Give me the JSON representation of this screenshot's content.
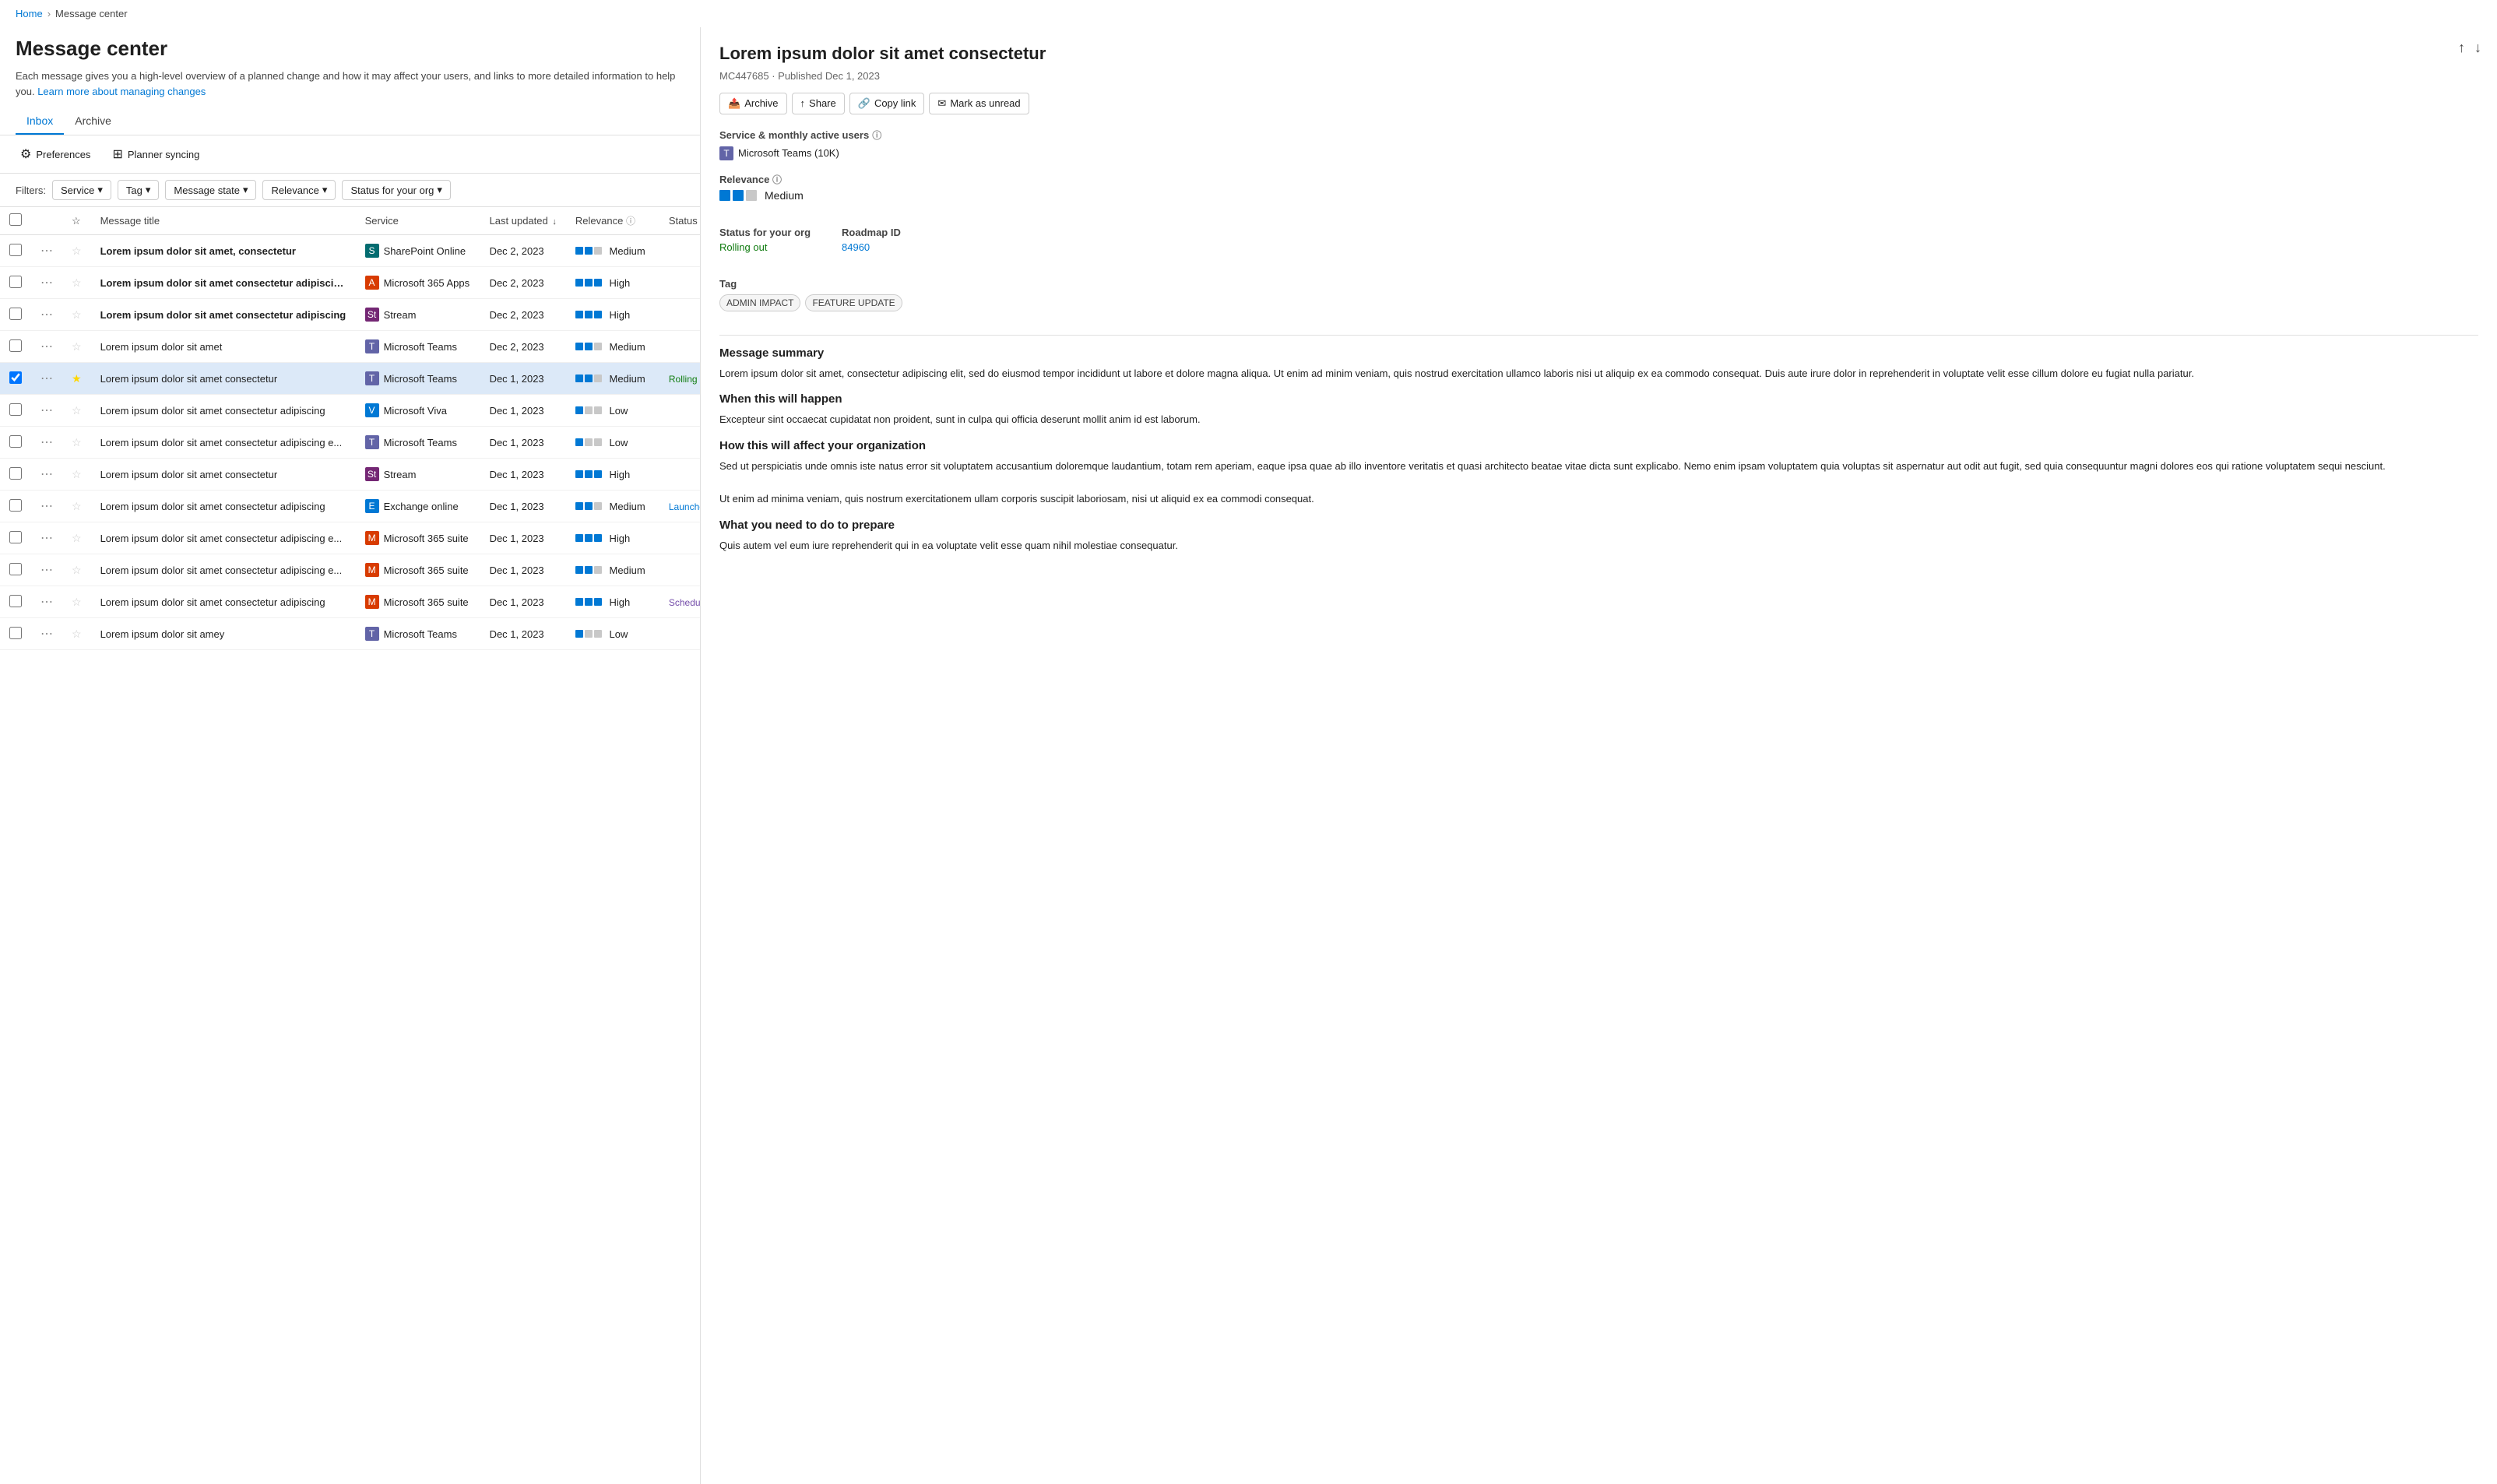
{
  "breadcrumb": {
    "home": "Home",
    "current": "Message center"
  },
  "page": {
    "title": "Message center",
    "description": "Each message gives you a high-level overview of a planned change and how it may affect your users, and links to more detailed information to help you.",
    "learn_more_text": "Learn more about managing changes"
  },
  "tabs": [
    {
      "id": "inbox",
      "label": "Inbox",
      "active": true
    },
    {
      "id": "archive",
      "label": "Archive",
      "active": false
    }
  ],
  "toolbar": {
    "preferences_label": "Preferences",
    "planner_label": "Planner syncing"
  },
  "filters": {
    "label": "Filters:",
    "items": [
      "Service",
      "Tag",
      "Message state",
      "Relevance",
      "Status for your org"
    ]
  },
  "table": {
    "columns": {
      "title": "Message title",
      "service": "Service",
      "last_updated": "Last updated",
      "relevance": "Relevance",
      "status": "Status for your org"
    },
    "rows": [
      {
        "id": 1,
        "selected": false,
        "starred": false,
        "bold": true,
        "title": "Lorem ipsum dolor sit amet, consectetur",
        "service": "SharePoint Online",
        "service_type": "sharepoint",
        "date": "Dec 2, 2023",
        "relevance": "Medium",
        "relevance_bars": 2,
        "status": ""
      },
      {
        "id": 2,
        "selected": false,
        "starred": false,
        "bold": true,
        "title": "Lorem ipsum dolor sit amet consectetur adipiscin...",
        "service": "Microsoft 365 Apps",
        "service_type": "m365apps",
        "date": "Dec 2, 2023",
        "relevance": "High",
        "relevance_bars": 3,
        "status": ""
      },
      {
        "id": 3,
        "selected": false,
        "starred": false,
        "bold": true,
        "title": "Lorem ipsum dolor sit amet consectetur adipiscing",
        "service": "Stream",
        "service_type": "stream",
        "date": "Dec 2, 2023",
        "relevance": "High",
        "relevance_bars": 3,
        "status": ""
      },
      {
        "id": 4,
        "selected": false,
        "starred": false,
        "bold": false,
        "title": "Lorem ipsum dolor sit amet",
        "service": "Microsoft Teams",
        "service_type": "teams",
        "date": "Dec 2, 2023",
        "relevance": "Medium",
        "relevance_bars": 2,
        "status": ""
      },
      {
        "id": 5,
        "selected": true,
        "starred": true,
        "bold": false,
        "title": "Lorem ipsum dolor sit amet consectetur",
        "service": "Microsoft Teams",
        "service_type": "teams",
        "date": "Dec 1, 2023",
        "relevance": "Medium",
        "relevance_bars": 2,
        "status": "Rolling out"
      },
      {
        "id": 6,
        "selected": false,
        "starred": false,
        "bold": false,
        "title": "Lorem ipsum dolor sit amet consectetur adipiscing",
        "service": "Microsoft Viva",
        "service_type": "viva",
        "date": "Dec 1, 2023",
        "relevance": "Low",
        "relevance_bars": 1,
        "status": ""
      },
      {
        "id": 7,
        "selected": false,
        "starred": false,
        "bold": false,
        "title": "Lorem ipsum dolor sit amet consectetur adipiscing e...",
        "service": "Microsoft Teams",
        "service_type": "teams",
        "date": "Dec 1, 2023",
        "relevance": "Low",
        "relevance_bars": 1,
        "status": ""
      },
      {
        "id": 8,
        "selected": false,
        "starred": false,
        "bold": false,
        "title": "Lorem ipsum dolor sit amet consectetur",
        "service": "Stream",
        "service_type": "stream",
        "date": "Dec 1, 2023",
        "relevance": "High",
        "relevance_bars": 3,
        "status": ""
      },
      {
        "id": 9,
        "selected": false,
        "starred": false,
        "bold": false,
        "title": "Lorem ipsum dolor sit amet consectetur adipiscing",
        "service": "Exchange online",
        "service_type": "exchange",
        "date": "Dec 1, 2023",
        "relevance": "Medium",
        "relevance_bars": 2,
        "status": "Launched"
      },
      {
        "id": 10,
        "selected": false,
        "starred": false,
        "bold": false,
        "title": "Lorem ipsum dolor sit amet consectetur adipiscing e...",
        "service": "Microsoft 365 suite",
        "service_type": "m365suite",
        "date": "Dec 1, 2023",
        "relevance": "High",
        "relevance_bars": 3,
        "status": ""
      },
      {
        "id": 11,
        "selected": false,
        "starred": false,
        "bold": false,
        "title": "Lorem ipsum dolor sit amet consectetur adipiscing e...",
        "service": "Microsoft 365 suite",
        "service_type": "m365suite",
        "date": "Dec 1, 2023",
        "relevance": "Medium",
        "relevance_bars": 2,
        "status": ""
      },
      {
        "id": 12,
        "selected": false,
        "starred": false,
        "bold": false,
        "title": "Lorem ipsum dolor sit amet consectetur adipiscing",
        "service": "Microsoft 365 suite",
        "service_type": "m365suite",
        "date": "Dec 1, 2023",
        "relevance": "High",
        "relevance_bars": 3,
        "status": "Scheduled"
      },
      {
        "id": 13,
        "selected": false,
        "starred": false,
        "bold": false,
        "title": "Lorem ipsum dolor sit amey",
        "service": "Microsoft Teams",
        "service_type": "teams",
        "date": "Dec 1, 2023",
        "relevance": "Low",
        "relevance_bars": 1,
        "status": ""
      }
    ]
  },
  "detail": {
    "title": "Lorem ipsum dolor sit amet consectetur",
    "meta": "MC447685 · Published Dec 1, 2023",
    "actions": {
      "archive": "Archive",
      "share": "Share",
      "copy_link": "Copy link",
      "mark_unread": "Mark as unread"
    },
    "service_section": {
      "label": "Service & monthly active users",
      "service": "Microsoft Teams (10K)"
    },
    "relevance": {
      "label": "Relevance",
      "value": "Medium",
      "bars": 2
    },
    "status_for_org": {
      "label": "Status for your org",
      "value": "Rolling out"
    },
    "roadmap": {
      "label": "Roadmap ID",
      "value": "84960"
    },
    "tags": {
      "label": "Tag",
      "items": [
        "ADMIN IMPACT",
        "FEATURE UPDATE"
      ]
    },
    "message_summary": {
      "label": "Message summary",
      "text": "Lorem ipsum dolor sit amet, consectetur adipiscing elit, sed do eiusmod tempor incididunt ut labore et dolore magna aliqua. Ut enim ad minim veniam, quis nostrud exercitation ullamco laboris nisi ut aliquip ex ea commodo consequat. Duis aute irure dolor in reprehenderit in voluptate velit esse cillum dolore eu fugiat nulla pariatur."
    },
    "when": {
      "label": "When this will happen",
      "text": "Excepteur sint occaecat cupidatat non proident, sunt in culpa qui officia deserunt mollit anim id est laborum."
    },
    "how_affect": {
      "label": "How this will affect your organization",
      "text": "Sed ut perspiciatis unde omnis iste natus error sit voluptatem accusantium doloremque laudantium, totam rem aperiam, eaque ipsa quae ab illo inventore veritatis et quasi architecto beatae vitae dicta sunt explicabo. Nemo enim ipsam voluptatem quia voluptas sit aspernatur aut odit aut fugit, sed quia consequuntur magni dolores eos qui ratione voluptatem sequi nesciunt.\n\nUt enim ad minima veniam, quis nostrum exercitationem ullam corporis suscipit laboriosam, nisi ut aliquid ex ea commodi consequat."
    },
    "what_to_do": {
      "label": "What you need to do to prepare",
      "text": "Quis autem vel eum iure reprehenderit qui in ea voluptate velit esse quam nihil molestiae consequatur."
    }
  },
  "icons": {
    "preferences": "⚙",
    "planner": "☰",
    "archive_action": "📥",
    "share": "↑",
    "copy": "🔗",
    "mark_unread": "✉",
    "chevron_down": "▾",
    "nav_up": "↑",
    "nav_down": "↓",
    "info": "ⓘ"
  }
}
